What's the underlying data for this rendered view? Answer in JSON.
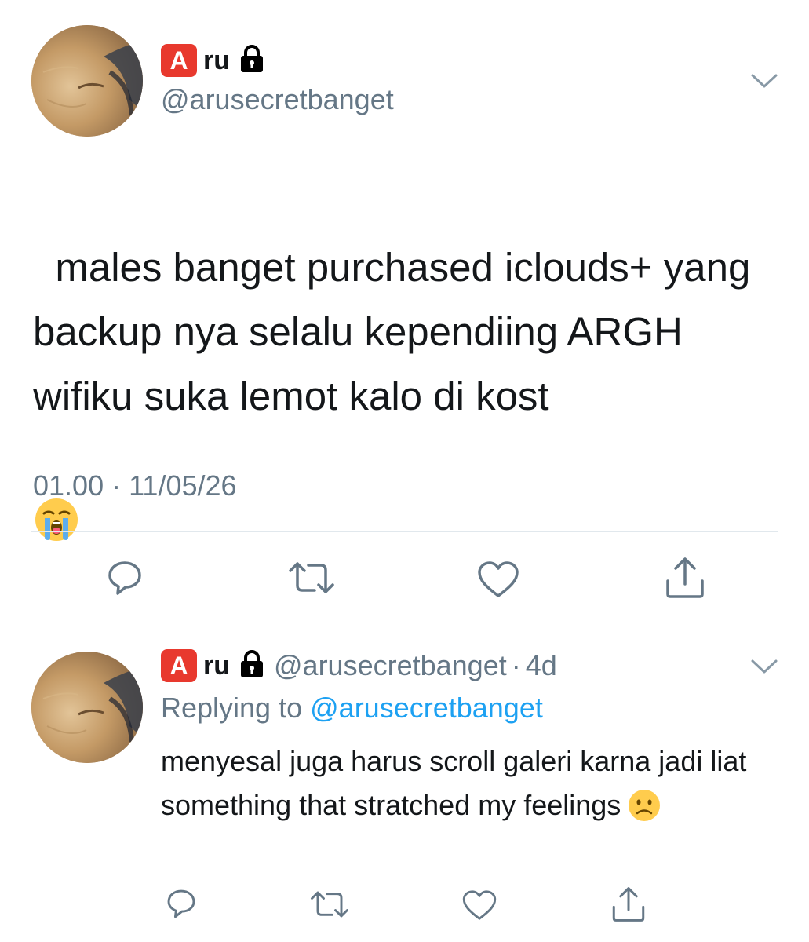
{
  "main_tweet": {
    "badge_letter": "A",
    "display_name": "ru",
    "handle": "@arusecretbanget",
    "text": "males banget purchased iclouds+ yang backup nya selalu kependiing ARGH wifiku suka lemot kalo di kost",
    "trailing_emoji": "loudly-crying-face",
    "timestamp": "01.00 · 11/05/26",
    "icons": {
      "reply": "reply-icon",
      "retweet": "retweet-icon",
      "like": "heart-icon",
      "share": "share-icon",
      "menu": "chevron-down-icon"
    }
  },
  "reply_tweet": {
    "badge_letter": "A",
    "display_name": "ru",
    "handle": "@arusecretbanget",
    "separator": "·",
    "age": "4d",
    "replying_prefix": "Replying to",
    "replying_mention": "@arusecretbanget",
    "text": "menyesal juga harus scroll galeri karna jadi liat something that stratched my feelings",
    "trailing_emoji": "frowning-face"
  },
  "colors": {
    "text_primary": "#14171a",
    "text_secondary": "#657786",
    "link": "#1da1f2",
    "divider": "#e1e8ed",
    "badge_red": "#e8392e"
  }
}
